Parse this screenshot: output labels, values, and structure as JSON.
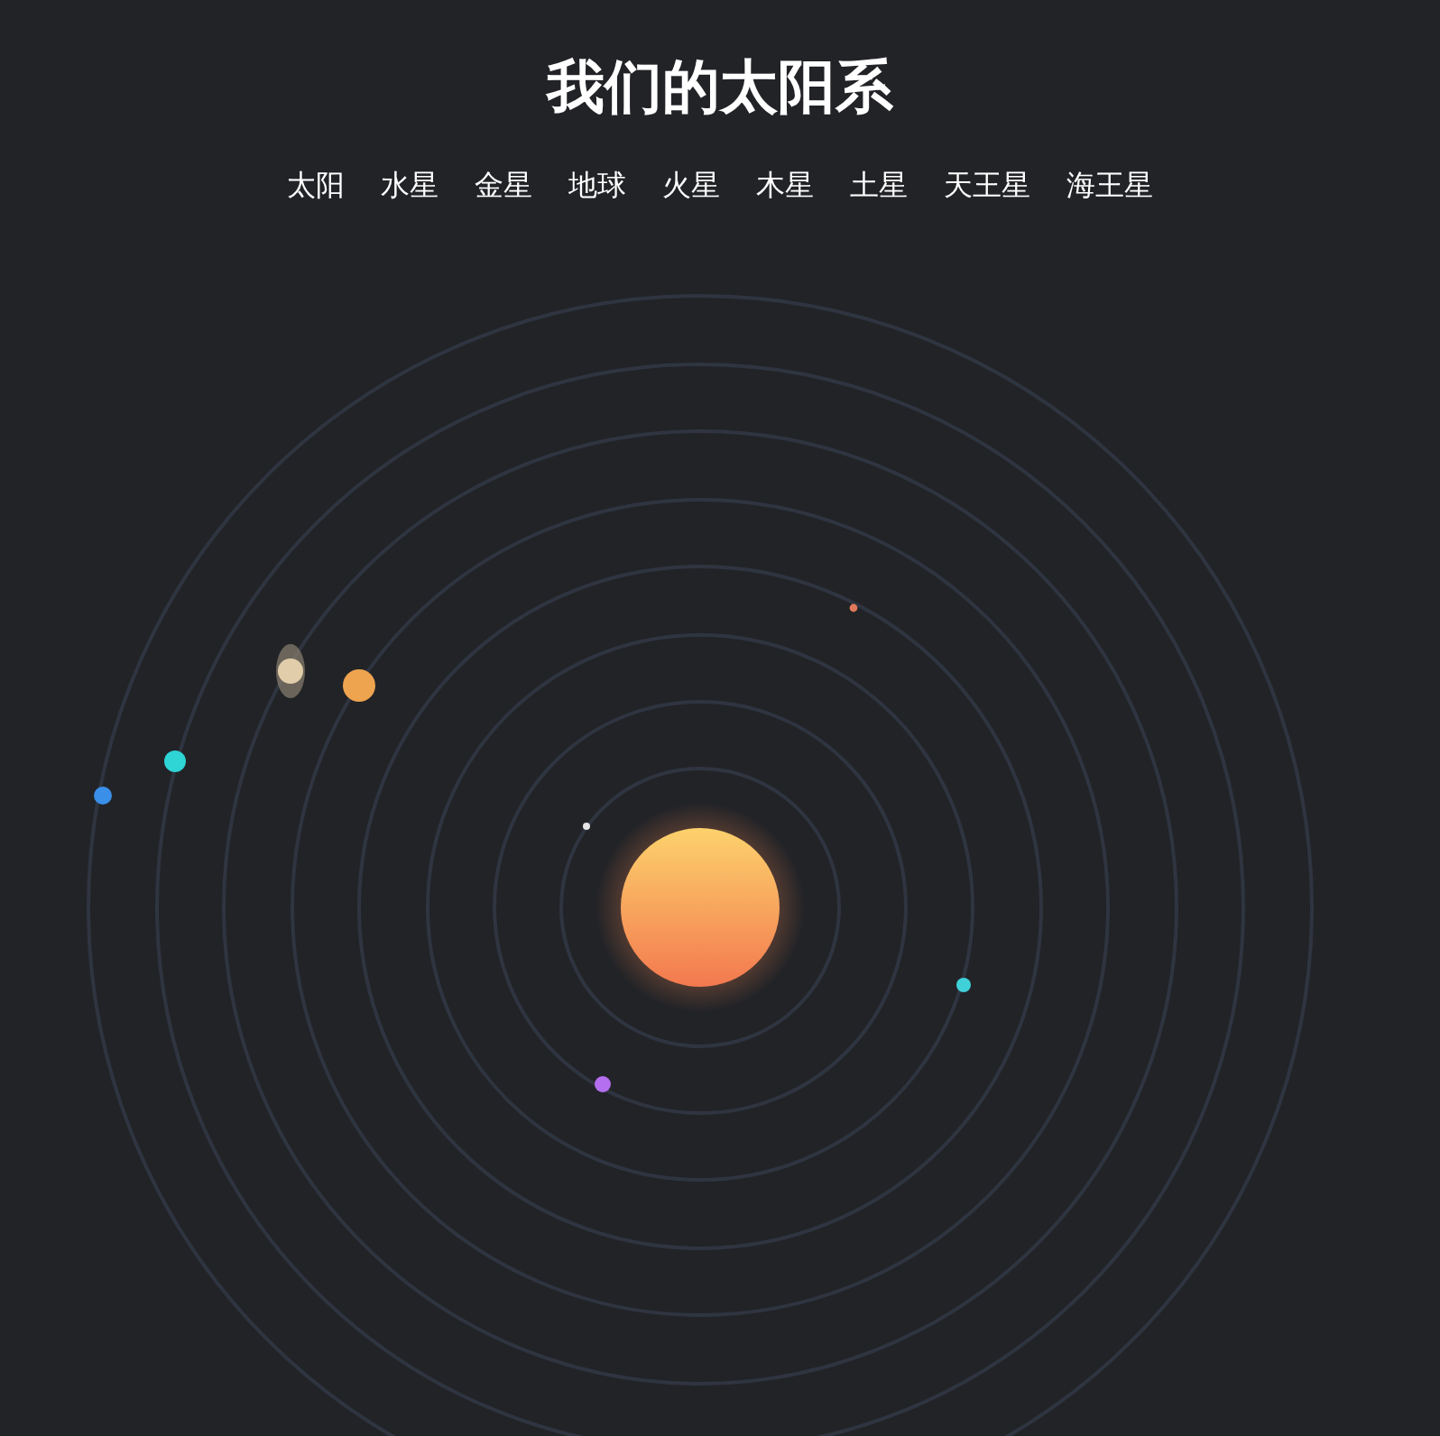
{
  "title": "我们的太阳系",
  "nav": [
    {
      "label": "太阳"
    },
    {
      "label": "水星"
    },
    {
      "label": "金星"
    },
    {
      "label": "地球"
    },
    {
      "label": "火星"
    },
    {
      "label": "木星"
    },
    {
      "label": "土星"
    },
    {
      "label": "天王星"
    },
    {
      "label": "海王星"
    }
  ]
}
